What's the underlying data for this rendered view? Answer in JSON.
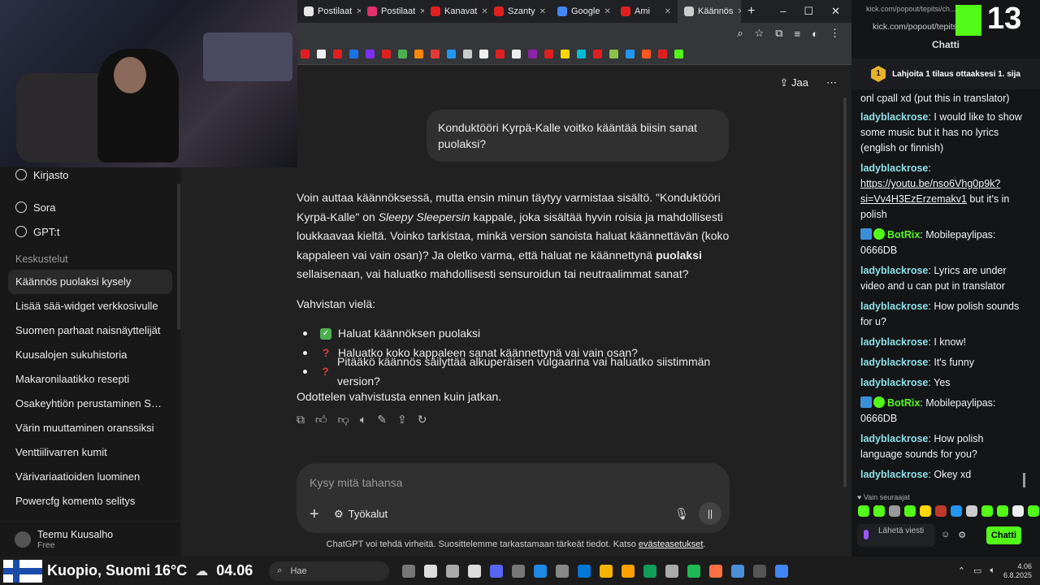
{
  "browser": {
    "tabs": [
      {
        "label": "Postilaat",
        "color": "#e6e6e6"
      },
      {
        "label": "Postilaat",
        "color": "#e1306c"
      },
      {
        "label": "Kanavat",
        "color": "#e02020"
      },
      {
        "label": "Szanty",
        "color": "#e02020"
      },
      {
        "label": "Google",
        "color": "#4285f4"
      },
      {
        "label": "Ami",
        "color": "#e02020"
      },
      {
        "label": "Käännös",
        "color": "#cccccc"
      }
    ],
    "new_tab": "+",
    "window_controls": [
      "–",
      "☐",
      "✕"
    ]
  },
  "sidebar": {
    "top_items": [
      {
        "label": "Kirjasto",
        "icon": "library-icon"
      },
      {
        "label": "Sora",
        "icon": "sora-icon"
      },
      {
        "label": "GPT:t",
        "icon": "gpts-icon"
      }
    ],
    "section_label": "Keskustelut",
    "conversations": [
      "Käännös puolaksi kysely",
      "Lisää sää-widget verkkosivulle",
      "Suomen parhaat naisnäyttelijät",
      "Kuusalojen sukuhistoria",
      "Makaronilaatikko resepti",
      "Osakeyhtiön perustaminen Suom...",
      "Värin muuttaminen oranssiksi",
      "Venttiilivarren kumit",
      "Värivariaatioiden luominen",
      "Powercfg komento selitys"
    ],
    "user": {
      "name": "Teemu Kuusalho",
      "plan": "Free"
    }
  },
  "chat": {
    "share_label": "Jaa",
    "user_message": "Konduktööri Kyrpä-Kalle voitko kääntää biisin sanat puolaksi?",
    "answer": {
      "p1_a": "Voin auttaa käännöksessä, mutta ensin minun täytyy varmistaa sisältö. \"Konduktööri Kyrpä-Kalle\" on ",
      "p1_em": "Sleepy Sleepersin",
      "p1_b": " kappale, joka sisältää hyvin roisia ja mahdollisesti loukkaavaa kieltä. Voinko tarkistaa, minkä version sanoista haluat käännettävän (koko kappaleen vai vain osan)? Ja oletko varma, että haluat ne käännettynä ",
      "p1_strong": "puolaksi",
      "p1_c": " sellaisenaan, vai haluatko mahdollisesti sensuroidun tai neutraalimmat sanat?",
      "p2": "Vahvistan vielä:",
      "bullets": [
        {
          "mark": "check",
          "text": "Haluat käännöksen puolaksi"
        },
        {
          "mark": "question",
          "text": "Haluatko koko kappaleen sanat käännettynä vai vain osan?"
        },
        {
          "mark": "question",
          "text": "Pitääkö käännös säilyttää alkuperäisen vulgaarina vai haluatko siistimmän version?"
        }
      ],
      "p3": "Odottelen vahvistusta ennen kuin jatkan."
    },
    "composer": {
      "placeholder": "Kysy mitä tahansa",
      "tools_label": "Työkalut"
    },
    "disclaimer": "ChatGPT voi tehdä virheitä. Suosittelemme tarkastamaan tärkeät tiedot. Katso ",
    "disclaimer_link": "evästeasetukset",
    "disclaimer_end": "."
  },
  "kick": {
    "url_small": "kick.com/popout/tepitsi/ch...",
    "url": "kick.com/popout/tepitsi/...",
    "logo_number": "13",
    "title": "Chatti",
    "sub_rank": "1",
    "sub_text": "Lahjoita 1 tilaus ottaaksesi 1. sija",
    "messages": [
      {
        "user": "",
        "text": "onl cpall xd (put this in translator)",
        "bot": false
      },
      {
        "user": "ladyblackrose",
        "text": "I would like to show some music but it has no lyrics (english or finnish)",
        "bot": false
      },
      {
        "user": "ladyblackrose",
        "text": "",
        "link": "https://youtu.be/nso6Vhg0p9k?si=Vv4H3EzErzemakv1",
        "tail": " but it's in polish",
        "bot": false
      },
      {
        "user": "BotRix",
        "text": "Mobilepaylipas: 0666DB",
        "bot": true
      },
      {
        "user": "ladyblackrose",
        "text": "Lyrics are under video and u can put in translator",
        "bot": false
      },
      {
        "user": "ladyblackrose",
        "text": "How polish sounds for u?",
        "bot": false
      },
      {
        "user": "ladyblackrose",
        "text": "I know!",
        "bot": false
      },
      {
        "user": "ladyblackrose",
        "text": "It's funny",
        "bot": false
      },
      {
        "user": "ladyblackrose",
        "text": "Yes",
        "bot": false
      },
      {
        "user": "BotRix",
        "text": "Mobilepaylipas: 0666DB",
        "bot": true
      },
      {
        "user": "ladyblackrose",
        "text": "How polish language sounds for you?",
        "bot": false
      },
      {
        "user": "ladyblackrose",
        "text": "Okey xd",
        "bot": false
      }
    ],
    "followers_only": "♥ Vain seuraajat",
    "input_placeholder": "Lähetä viesti",
    "send_label": "Chatti"
  },
  "taskbar": {
    "weather": "Kuopio, Suomi 16°C",
    "big_time": "04.06",
    "search_placeholder": "Hae",
    "clock_time": "4.06",
    "clock_date": "6.8.2025"
  }
}
